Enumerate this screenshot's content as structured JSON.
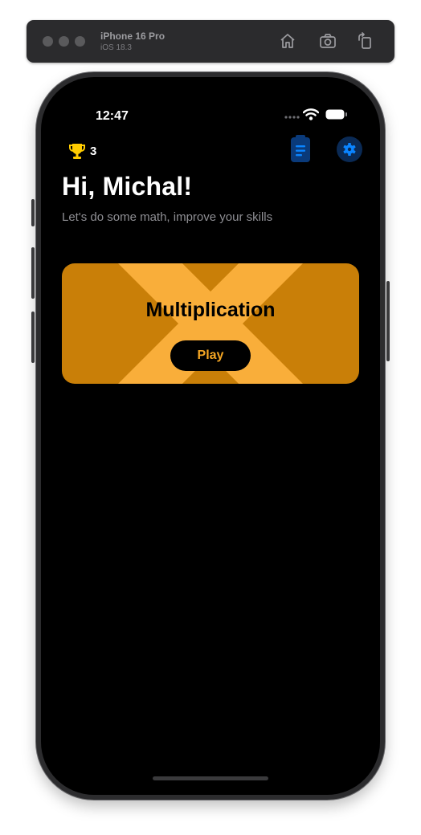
{
  "simulator": {
    "device_name": "iPhone 16 Pro",
    "os_version": "iOS 18.3",
    "icons": [
      "home-icon",
      "screenshot-icon",
      "rotate-icon"
    ]
  },
  "status_bar": {
    "time": "12:47",
    "icons": [
      "cellular-icon",
      "wifi-icon",
      "battery-icon"
    ]
  },
  "header": {
    "trophy_count": "3",
    "icons": [
      "trophy-icon",
      "clipboard-icon",
      "gear-icon"
    ]
  },
  "greeting": {
    "title": "Hi, Michal!",
    "subtitle": "Let's do some math, improve your skills"
  },
  "cards": [
    {
      "title": "Multiplication",
      "button_label": "Play"
    }
  ],
  "colors": {
    "card_background": "#c97f08",
    "card_pattern": "#f9ae3a",
    "play_text": "#f5a623",
    "accent_blue": "#0a84ff",
    "trophy": "#ffcc00"
  }
}
